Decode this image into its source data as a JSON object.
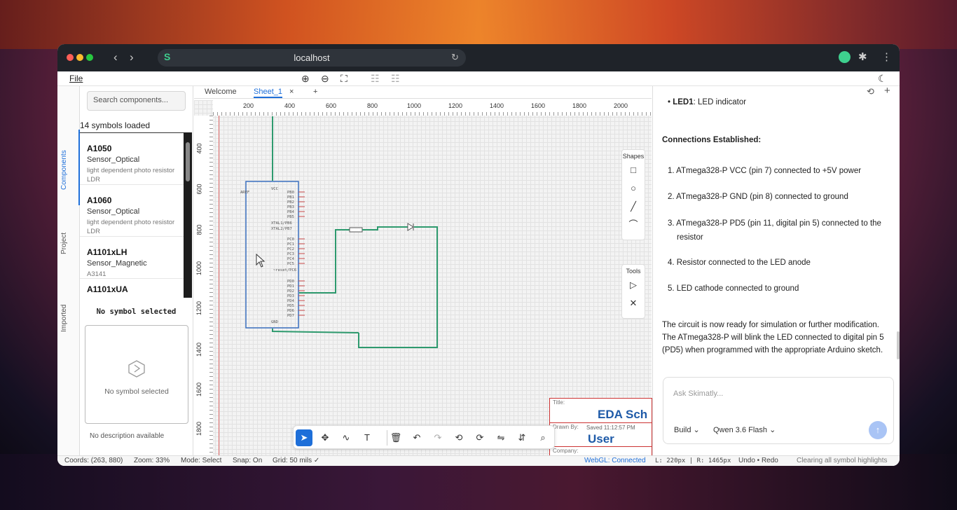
{
  "browser": {
    "url": "localhost"
  },
  "menu": {
    "file": "File"
  },
  "sidebar": {
    "tabs": [
      "Components",
      "Project",
      "Imported"
    ],
    "search_placeholder": "Search components...",
    "loaded_count": "14 symbols loaded",
    "components": [
      {
        "name": "A1050",
        "category": "Sensor_Optical",
        "description": "light dependent photo resistor LDR"
      },
      {
        "name": "A1060",
        "category": "Sensor_Optical",
        "description": "light dependent photo resistor LDR"
      },
      {
        "name": "A1101xLH",
        "category": "Sensor_Magnetic",
        "description": "A3141"
      },
      {
        "name": "A1101xUA",
        "category": "",
        "description": ""
      }
    ],
    "selection_title": "No symbol selected",
    "preview_text": "No symbol selected",
    "description_text": "No description available"
  },
  "editor": {
    "tabs": [
      "Welcome",
      "Sheet_1"
    ],
    "ruler_top": [
      "200",
      "400",
      "600",
      "800",
      "1000",
      "1200",
      "1400",
      "1600",
      "1800",
      "2000"
    ],
    "ruler_left": [
      "400",
      "600",
      "800",
      "1000",
      "1200",
      "1400",
      "1600",
      "1800"
    ],
    "shapes_title": "Shapes",
    "tools_title": "Tools",
    "title_block": {
      "title_label": "Title:",
      "title_value": "EDA Sch",
      "drawn_label": "Drawn By:",
      "saved": "Saved 11:12:57 PM",
      "user": "User",
      "company_label": "Company:"
    }
  },
  "chat": {
    "led_line_name": "LED1",
    "led_line_text": ": LED indicator",
    "connections_heading": "Connections Established:",
    "connections": [
      "ATmega328-P VCC (pin 7) connected to +5V power",
      "ATmega328-P GND (pin 8) connected to ground",
      "ATmega328-P PD5 (pin 11, digital pin 5) connected to the resistor",
      "Resistor connected to the LED anode",
      "LED cathode connected to ground"
    ],
    "summary": "The circuit is now ready for simulation or further modification. The ATmega328-P will blink the LED connected to digital pin 5 (PD5) when programmed with the appropriate Arduino sketch.",
    "input_placeholder": "Ask Skimatly...",
    "mode": "Build",
    "model": "Qwen 3.6 Flash"
  },
  "status": {
    "coords": "Coords: (263, 880)",
    "zoom": "Zoom: 33%",
    "mode": "Mode: Select",
    "snap": "Snap: On",
    "grid": "Grid: 50 mils ✓",
    "webgl": "WebGL: Connected",
    "lr": "L: 220px | R: 1465px",
    "undo": "Undo • Redo",
    "message": "Clearing all symbol highlights"
  },
  "colors": {
    "accent": "#1e6fd9",
    "wire": "#2e9a6e",
    "brand": "#3ecf8e"
  }
}
